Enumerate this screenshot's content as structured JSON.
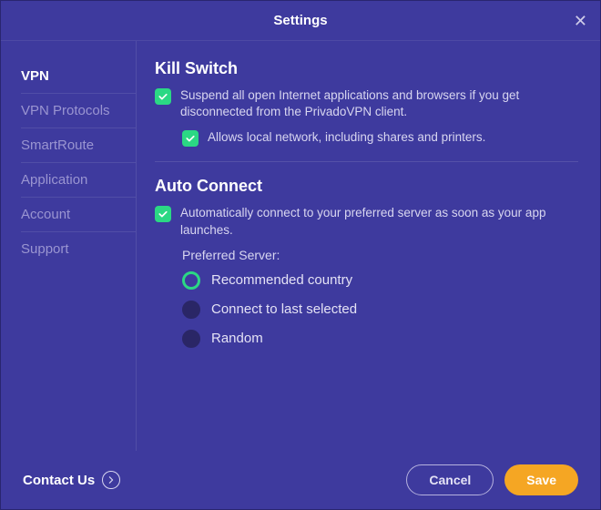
{
  "header": {
    "title": "Settings"
  },
  "sidebar": {
    "items": [
      {
        "label": "VPN",
        "active": true
      },
      {
        "label": "VPN Protocols",
        "active": false
      },
      {
        "label": "SmartRoute",
        "active": false
      },
      {
        "label": "Application",
        "active": false
      },
      {
        "label": "Account",
        "active": false
      },
      {
        "label": "Support",
        "active": false
      }
    ]
  },
  "main": {
    "killswitch": {
      "title": "Kill Switch",
      "suspend_label": "Suspend all open Internet applications and browsers if you get disconnected from the PrivadoVPN client.",
      "local_label": "Allows local network, including shares and printers."
    },
    "autoconnect": {
      "title": "Auto Connect",
      "desc": "Automatically connect to your preferred server as soon as your app launches.",
      "preferred_label": "Preferred Server:",
      "options": [
        "Recommended country",
        "Connect to last selected",
        "Random"
      ],
      "selected_index": 0
    }
  },
  "footer": {
    "contact_label": "Contact Us",
    "cancel_label": "Cancel",
    "save_label": "Save"
  },
  "colors": {
    "background": "#3e3a9e",
    "accent_green": "#2bd884",
    "accent_orange": "#f5a623"
  }
}
